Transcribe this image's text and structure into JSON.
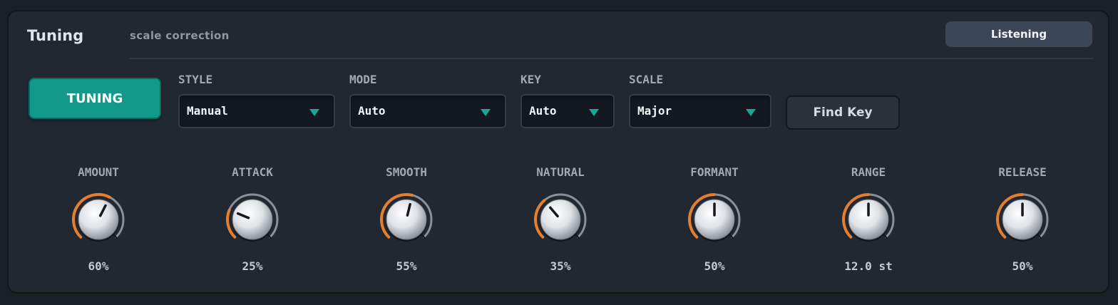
{
  "header": {
    "title": "Tuning",
    "subtitle": "scale correction",
    "status": "Listening"
  },
  "controls": {
    "tuning_toggle": "TUNING",
    "find_key_label": "Find Key",
    "dropdowns": [
      {
        "label": "STYLE",
        "value": "Manual"
      },
      {
        "label": "MODE",
        "value": "Auto"
      },
      {
        "label": "KEY",
        "value": "Auto"
      },
      {
        "label": "SCALE",
        "value": "Major"
      }
    ]
  },
  "knobs": [
    {
      "label": "AMOUNT",
      "value": "60%",
      "level": 0.6
    },
    {
      "label": "ATTACK",
      "value": "25%",
      "level": 0.25
    },
    {
      "label": "SMOOTH",
      "value": "55%",
      "level": 0.55
    },
    {
      "label": "NATURAL",
      "value": "35%",
      "level": 0.35
    },
    {
      "label": "FORMANT",
      "value": "50%",
      "level": 0.5
    },
    {
      "label": "RANGE",
      "value": "12.0 st",
      "level": 0.5
    },
    {
      "label": "RELEASE",
      "value": "50%",
      "level": 0.5
    }
  ],
  "colors": {
    "accent": "#e57f2e",
    "track": "#8b9098",
    "tuning_button": "#12998a",
    "chevron": "#1aa894"
  }
}
